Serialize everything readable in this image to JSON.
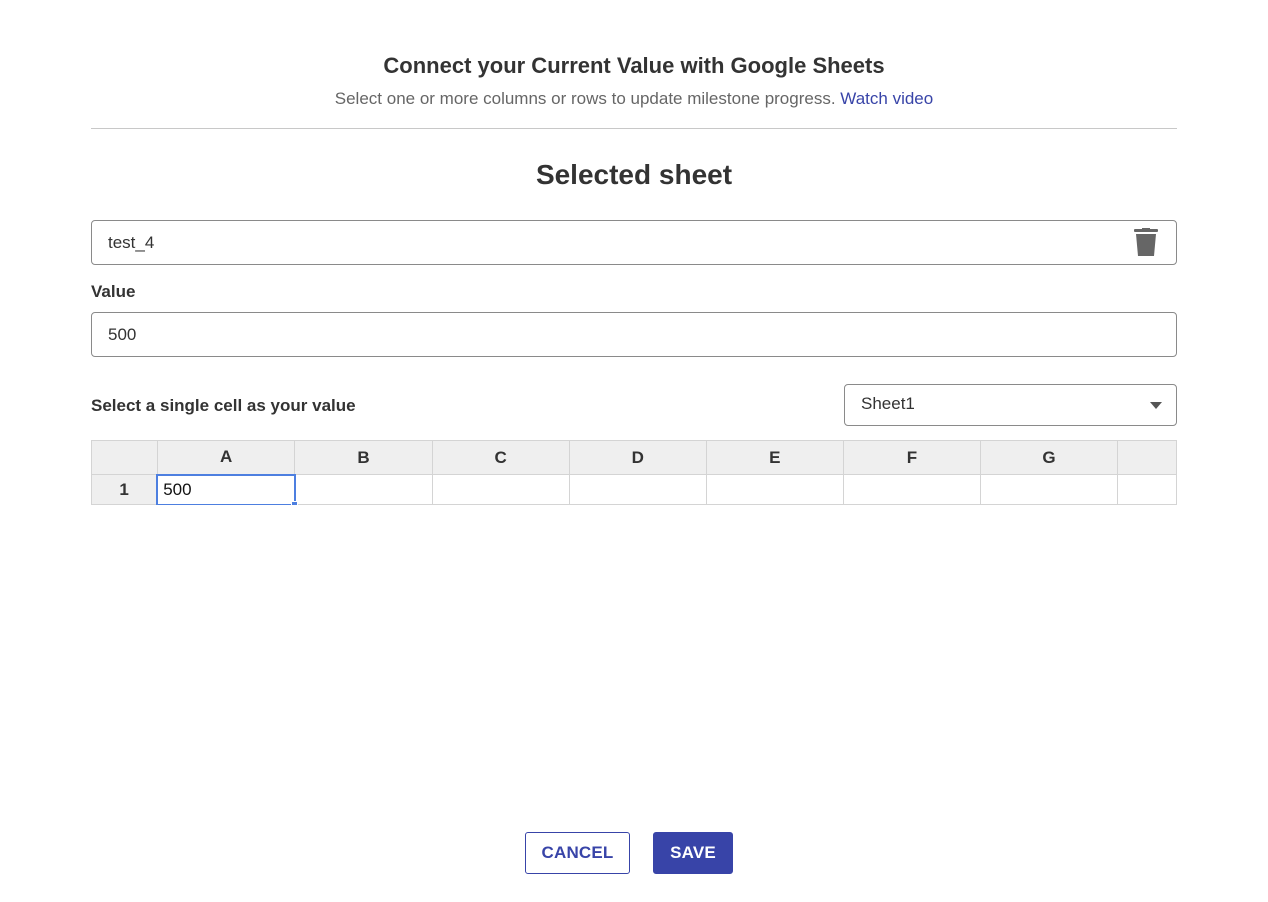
{
  "header": {
    "title": "Connect your Current Value with Google Sheets",
    "subtitle": "Select one or more columns or rows to update milestone progress.",
    "link": "Watch video"
  },
  "section": {
    "title": "Selected sheet"
  },
  "sheet": {
    "name": "test_4",
    "delete_icon": "trash-icon"
  },
  "value": {
    "label": "Value",
    "input_value": "500"
  },
  "cell_select": {
    "label": "Select a single cell as your value"
  },
  "tab_select": {
    "selected": "Sheet1"
  },
  "grid": {
    "columns": [
      "A",
      "B",
      "C",
      "D",
      "E",
      "F",
      "G",
      ""
    ],
    "rows": [
      {
        "header": "1",
        "cells": [
          "500",
          "",
          "",
          "",
          "",
          "",
          "",
          ""
        ]
      }
    ],
    "selected_cell": "A1"
  },
  "buttons": {
    "cancel": "CANCEL",
    "save": "SAVE"
  },
  "colors": {
    "accent": "#3844a8",
    "selection": "#4d7fe0",
    "grid_header": "#efefef"
  }
}
